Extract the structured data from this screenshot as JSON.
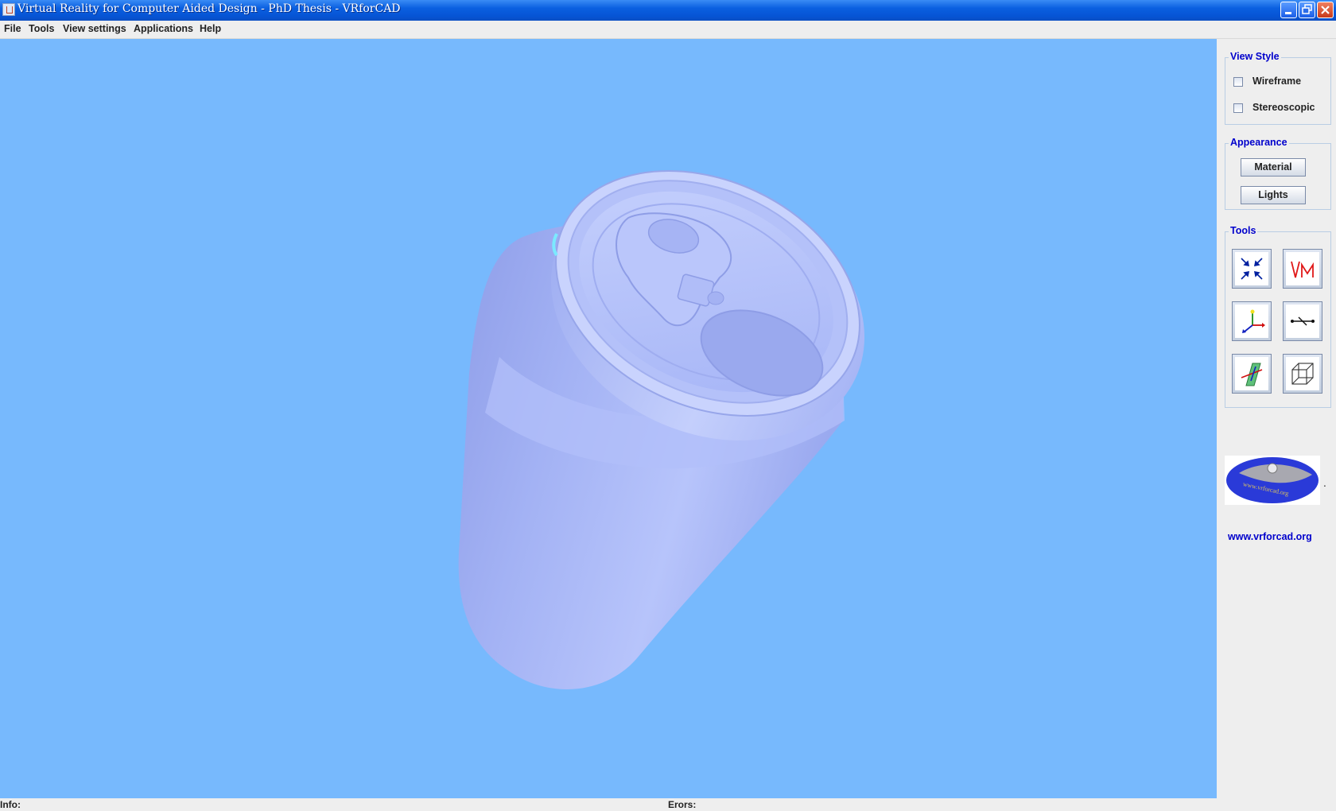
{
  "window": {
    "title": "Virtual Reality for Computer Aided Design - PhD Thesis  - VRforCAD",
    "controls": [
      "minimize",
      "restore",
      "close"
    ]
  },
  "menu": {
    "items": [
      {
        "label": "File"
      },
      {
        "label": "Tools"
      },
      {
        "label": "View settings"
      },
      {
        "label": "Applications"
      },
      {
        "label": "Help"
      }
    ]
  },
  "viewport": {
    "background": "#77b9fd",
    "object": "beverage-can-3d-model",
    "model_color": "#a9b8f7"
  },
  "panel": {
    "view_style": {
      "title": "View Style",
      "options": [
        {
          "label": "Wireframe",
          "checked": false
        },
        {
          "label": "Stereoscopic",
          "checked": false
        }
      ]
    },
    "appearance": {
      "title": "Appearance",
      "buttons": [
        {
          "label": "Material"
        },
        {
          "label": "Lights"
        }
      ]
    },
    "tools": {
      "title": "Tools",
      "buttons": [
        {
          "icon": "fit-view-arrows-icon"
        },
        {
          "icon": "vm-icon"
        },
        {
          "icon": "axes-icon"
        },
        {
          "icon": "line-measure-icon"
        },
        {
          "icon": "section-plane-icon"
        },
        {
          "icon": "cube-wireframe-icon"
        }
      ]
    },
    "logo": {
      "text": "www.vrforcad.org",
      "dot": "."
    },
    "website": "www.vrforcad.org"
  },
  "status": {
    "info_label": "Info:",
    "errors_label": "Erors:"
  },
  "colors": {
    "title_bar": "#0a5fe0",
    "group_title": "#0000cc",
    "viewport_bg": "#77b9fd"
  }
}
